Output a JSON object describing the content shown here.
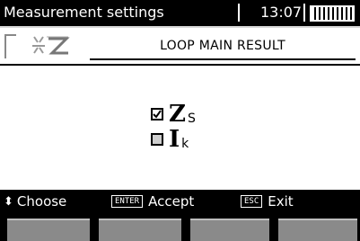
{
  "status": {
    "title": "Measurement settings",
    "time": "13:07",
    "battery_level": 1.0
  },
  "header": {
    "title": "LOOP MAIN RESULT",
    "icon": "zs-loop-icon"
  },
  "options": [
    {
      "main": "Z",
      "sub": "S",
      "checked": true
    },
    {
      "main": "I",
      "sub": "k",
      "checked": false
    }
  ],
  "footer": {
    "choose_label": "Choose",
    "enter_badge": "ENTER",
    "accept_label": "Accept",
    "esc_badge": "ESC",
    "exit_label": "Exit"
  },
  "colors": {
    "background": "#000000",
    "panel": "#ffffff",
    "softkey": "#8a8a8a"
  }
}
